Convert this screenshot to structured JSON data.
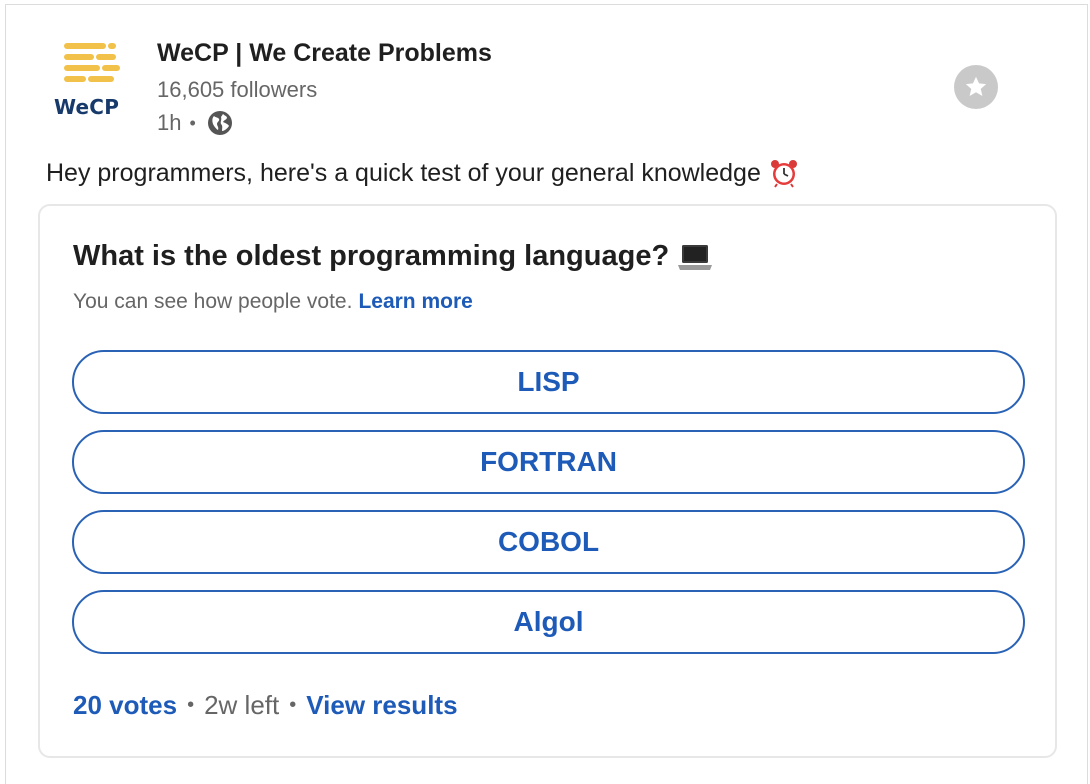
{
  "header": {
    "logo_text": "WeCP",
    "org_name": "WeCP | We Create Problems",
    "followers": "16,605 followers",
    "time": "1h",
    "separator": "•",
    "visibility_icon": "globe-icon",
    "follow_icon": "star-icon"
  },
  "post": {
    "text": "Hey programmers, here's a quick test of your general knowledge",
    "emoji_icon": "alarm-clock-icon"
  },
  "poll": {
    "question": "What is the oldest programming language?",
    "question_icon": "laptop-icon",
    "disclaimer": "You can see how people vote.",
    "learn_more": "Learn more",
    "options": [
      {
        "label": "LISP"
      },
      {
        "label": "FORTRAN"
      },
      {
        "label": "COBOL"
      },
      {
        "label": "Algol"
      }
    ],
    "votes": "20 votes",
    "separator": "•",
    "time_left": "2w left",
    "view_results": "View results"
  },
  "colors": {
    "accent": "#1e5bb8",
    "text": "#1f1f1f",
    "muted": "#666666",
    "logo_yellow": "#f2c14a",
    "logo_navy": "#173a6b"
  }
}
